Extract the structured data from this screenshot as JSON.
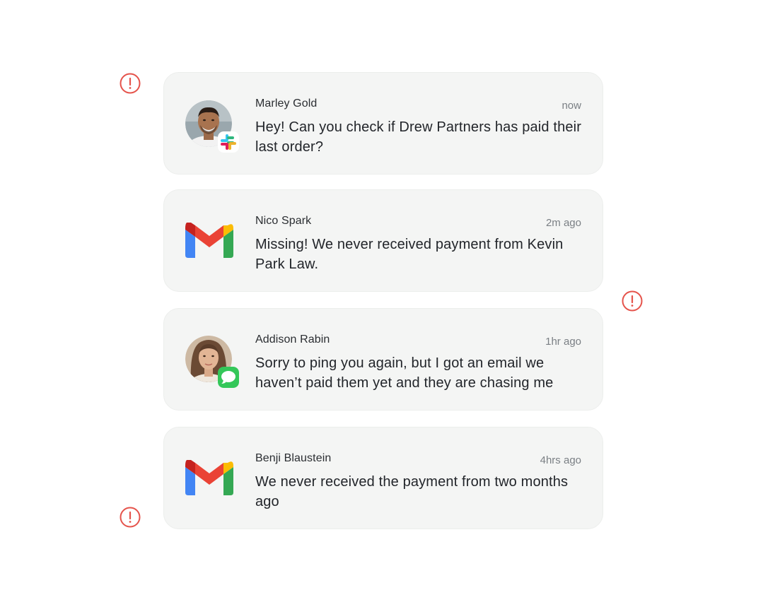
{
  "notifications": [
    {
      "sender": "Marley Gold",
      "time": "now",
      "message": "Hey! Can you check if Drew Partners has paid their last order?",
      "source": "slack-icon"
    },
    {
      "sender": "Nico Spark",
      "time": "2m ago",
      "message": "Missing! We never received payment from Kevin Park Law.",
      "source": "gmail-icon"
    },
    {
      "sender": "Addison Rabin",
      "time": "1hr ago",
      "message": "Sorry to ping you again, but I got an email we haven’t paid them yet and they are chasing me",
      "source": "imessage-icon"
    },
    {
      "sender": "Benji Blaustein",
      "time": "4hrs ago",
      "message": "We never received the payment from two months ago",
      "source": "gmail-icon"
    }
  ],
  "colors": {
    "alert": "#e5534b",
    "card_bg": "#f4f5f4",
    "gmail_red": "#ea4335",
    "gmail_blue": "#4285f4",
    "gmail_green": "#34a853",
    "gmail_yellow": "#fbbc04",
    "imessage_green": "#34c759"
  }
}
